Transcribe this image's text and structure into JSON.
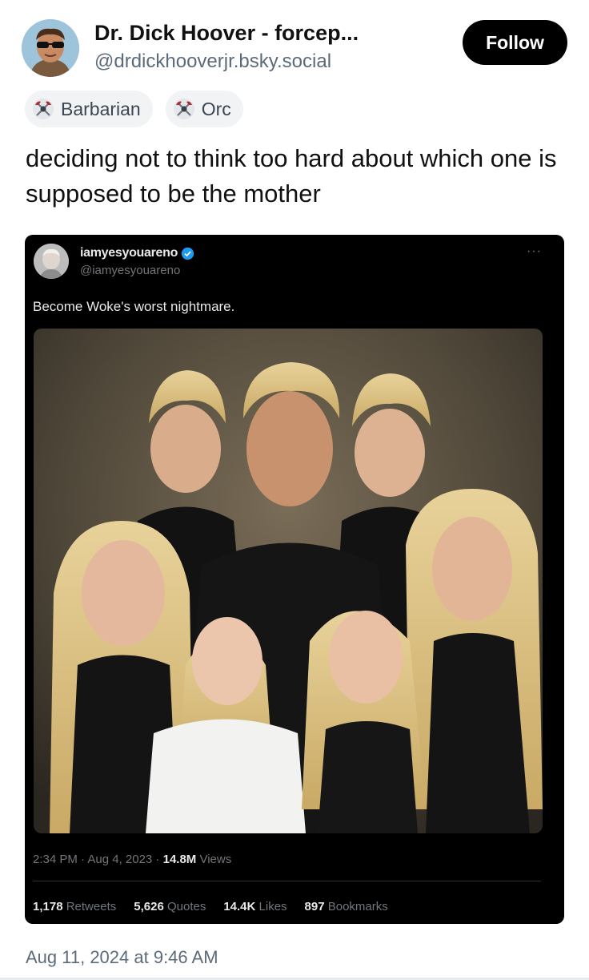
{
  "author": {
    "display_name": "Dr. Dick Hoover - forcep...",
    "handle": "@drdickhooverjr.bsky.social",
    "avatar_icon": "avatar-sunglasses-icon"
  },
  "follow_label": "Follow",
  "badges": [
    {
      "label": "Barbarian",
      "icon": "axes-crest-icon"
    },
    {
      "label": "Orc",
      "icon": "axes-crest-icon"
    }
  ],
  "post_text": "deciding not to think too hard about which one is supposed to be the mother",
  "quoted_post": {
    "display_name": "iamyesyouareno",
    "handle": "@iamyesyouareno",
    "verified_icon": "verified-badge-icon",
    "more_icon": "more-dots-icon",
    "more_label": "···",
    "text": "Become Woke's worst nightmare.",
    "time": "2:34 PM · Aug 4, 2023 · ",
    "views_count": "14.8M",
    "views_label": " Views",
    "stats": [
      {
        "count": "1,178",
        "label": " Retweets"
      },
      {
        "count": "5,626",
        "label": " Quotes"
      },
      {
        "count": "14.4K",
        "label": " Likes"
      },
      {
        "count": "897",
        "label": " Bookmarks"
      }
    ]
  },
  "timestamp": "Aug 11, 2024 at 9:46 AM",
  "colors": {
    "follow_bg": "#000000",
    "quote_bg": "#000000",
    "verified": "#1d9bf0",
    "muted": "#5c6b7a"
  }
}
